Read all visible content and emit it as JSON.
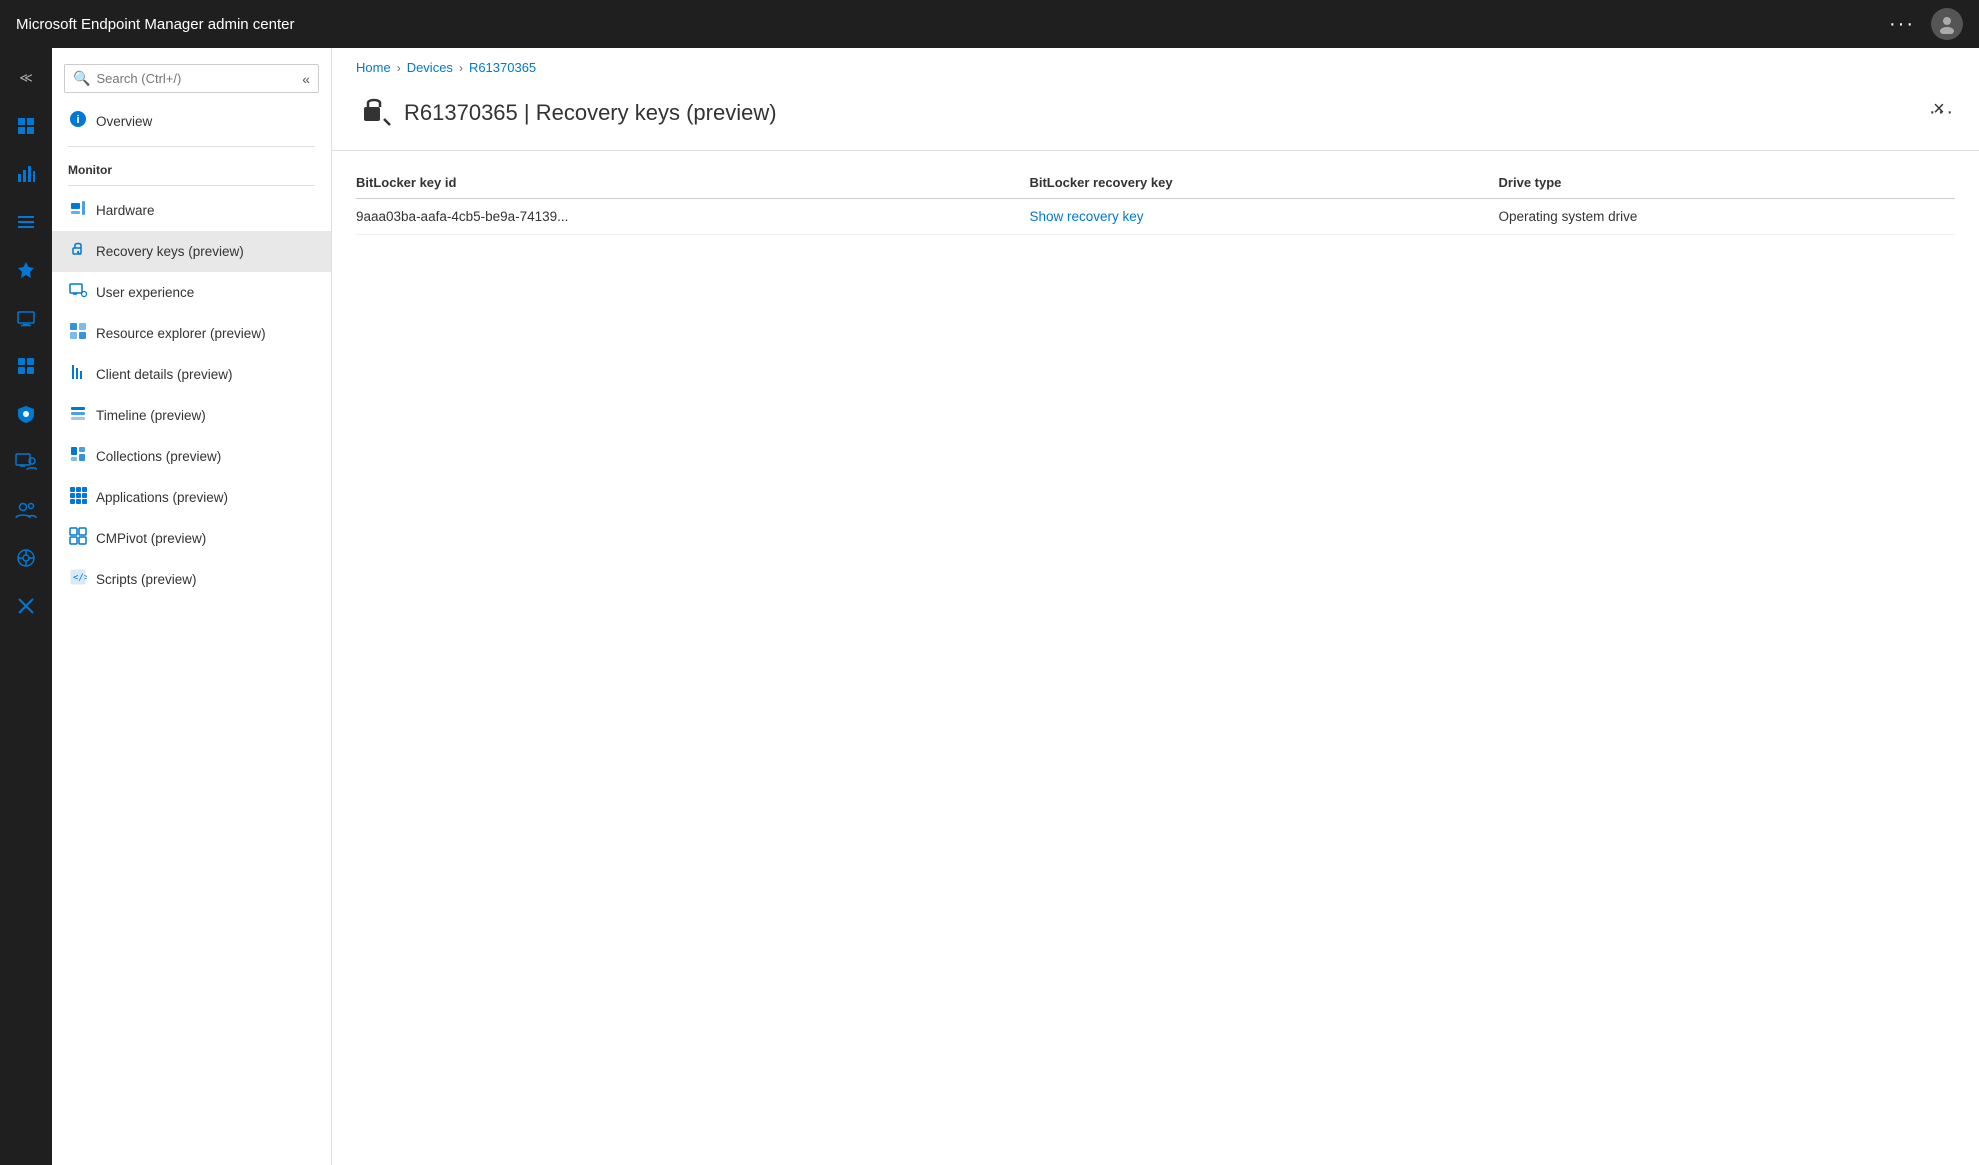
{
  "app": {
    "title": "Microsoft Endpoint Manager admin center",
    "ellipsis": "···"
  },
  "breadcrumb": {
    "items": [
      "Home",
      "Devices",
      "R61370365"
    ],
    "separators": [
      ">",
      ">"
    ]
  },
  "page_header": {
    "title": "R61370365 | Recovery keys (preview)",
    "ellipsis": "···",
    "close": "×"
  },
  "search": {
    "placeholder": "Search (Ctrl+/)"
  },
  "sidebar": {
    "overview_label": "Overview",
    "section_monitor": "Monitor",
    "items": [
      {
        "label": "Hardware",
        "icon": "hardware"
      },
      {
        "label": "Recovery keys (preview)",
        "icon": "recovery",
        "active": true
      },
      {
        "label": "User experience",
        "icon": "user-exp"
      },
      {
        "label": "Resource explorer (preview)",
        "icon": "resource"
      },
      {
        "label": "Client details (preview)",
        "icon": "client"
      },
      {
        "label": "Timeline (preview)",
        "icon": "timeline"
      },
      {
        "label": "Collections (preview)",
        "icon": "collections"
      },
      {
        "label": "Applications (preview)",
        "icon": "apps"
      },
      {
        "label": "CMPivot (preview)",
        "icon": "cmpivot"
      },
      {
        "label": "Scripts (preview)",
        "icon": "scripts"
      }
    ]
  },
  "table": {
    "columns": [
      "BitLocker key id",
      "BitLocker recovery key",
      "Drive type"
    ],
    "rows": [
      {
        "key_id": "9aaa03ba-aafa-4cb5-be9a-74139...",
        "recovery_key_label": "Show recovery key",
        "drive_type": "Operating system drive"
      }
    ]
  },
  "icon_rail": {
    "items": [
      {
        "name": "collapse",
        "symbol": "≪"
      },
      {
        "name": "dashboard",
        "symbol": "⊞"
      },
      {
        "name": "chart",
        "symbol": "📊"
      },
      {
        "name": "list",
        "symbol": "☰"
      },
      {
        "name": "star",
        "symbol": "★"
      },
      {
        "name": "devices",
        "symbol": "⬜"
      },
      {
        "name": "apps-grid",
        "symbol": "⊞"
      },
      {
        "name": "shield",
        "symbol": "🛡"
      },
      {
        "name": "monitor-user",
        "symbol": "👤"
      },
      {
        "name": "settings-person",
        "symbol": "👥"
      },
      {
        "name": "tenant-admin",
        "symbol": "⚙"
      },
      {
        "name": "troubleshoot",
        "symbol": "✕"
      }
    ]
  }
}
